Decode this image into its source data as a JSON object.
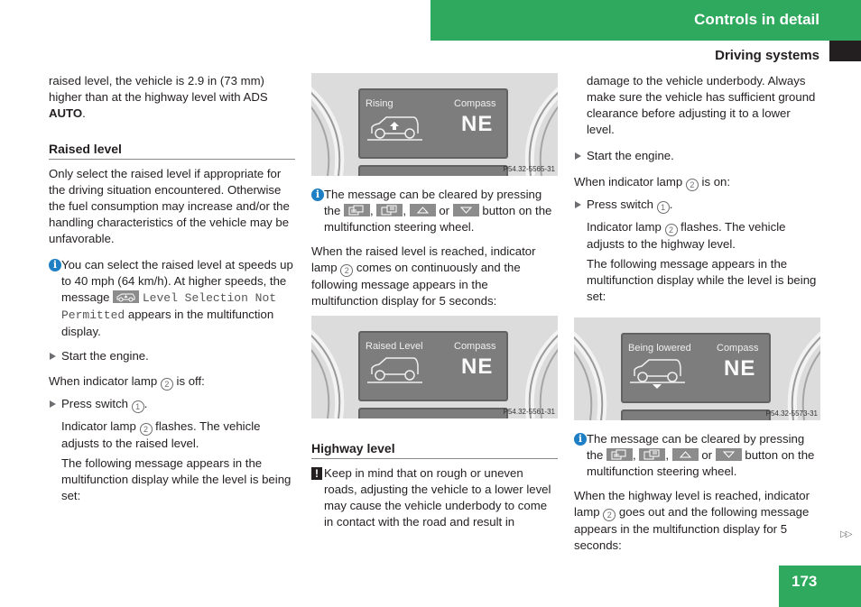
{
  "header": {
    "chapter": "Controls in detail",
    "section": "Driving systems"
  },
  "col1": {
    "intro": {
      "pre": "raised level, the vehicle is 2.9 in (73 mm) higher than at the highway level with ADS ",
      "bold": "AUTO",
      "post": "."
    },
    "raised_heading": "Raised level",
    "raised_para": "Only select the raised level if appropriate for the driving situation encountered. Otherwise the fuel consumption may increase and/or the handling characteristics of the vehicle may be unfavorable.",
    "note": {
      "icon": "info-icon",
      "pre": "You can select the raised level at speeds up to 40 mph (64 km/h). At higher speeds, the message ",
      "mono": "Level Selection Not Permitted",
      "post": " appears in the multifunction display."
    },
    "step_start": "Start the engine.",
    "condition": {
      "pre": "When indicator lamp ",
      "num": "2",
      "post": " is off:"
    },
    "step_press": {
      "pre": "Press switch ",
      "num": "1",
      "post": "."
    },
    "result1": {
      "pre": "Indicator lamp ",
      "num": "2",
      "post": " flashes. The vehicle adjusts to the raised level."
    },
    "result2": "The following message appears in the multifunction display while the level is being set:"
  },
  "col2": {
    "display1": {
      "left_label": "Rising",
      "right_label": "Compass",
      "direction": "NE",
      "fig_code": "P54.32-5565-31",
      "car_state": "rising"
    },
    "note": {
      "icon": "info-icon",
      "pre": "The message can be cleared by pressing the ",
      "sep1": ", ",
      "sep2": ", ",
      "sep3": " or ",
      "post": " button on the multifunction steering wheel."
    },
    "reached": {
      "pre": "When the raised level is reached, indicator lamp ",
      "num": "2",
      "post": " comes on continuously and the following message appears in the multifunction display for 5 seconds:"
    },
    "display2": {
      "left_label": "Raised Level",
      "right_label": "Compass",
      "direction": "NE",
      "fig_code": "P54.32-5561-31",
      "car_state": "raised"
    },
    "highway_heading": "Highway level",
    "warning": {
      "icon": "warning-icon",
      "text": "Keep in mind that on rough or uneven roads, adjusting the vehicle to a lower level may cause the vehicle underbody to come in contact with the road and result in"
    }
  },
  "col3": {
    "warning_cont": "damage to the vehicle underbody. Always make sure the vehicle has sufficient ground clearance before adjusting it to a lower level.",
    "step_start": "Start the engine.",
    "condition": {
      "pre": "When indicator lamp ",
      "num": "2",
      "post": " is on:"
    },
    "step_press": {
      "pre": "Press switch ",
      "num": "1",
      "post": "."
    },
    "result1": {
      "pre": "Indicator lamp ",
      "num": "2",
      "post": " flashes. The vehicle adjusts to the highway level."
    },
    "result2": "The following message appears in the multifunction display while the level is being set:",
    "display3": {
      "left_label": "Being lowered",
      "right_label": "Compass",
      "direction": "NE",
      "fig_code": "P54.32-5573-31",
      "car_state": "lowering"
    },
    "note": {
      "icon": "info-icon",
      "pre": "The message can be cleared by pressing the ",
      "sep1": ", ",
      "sep2": ", ",
      "sep3": " or ",
      "post": " button on the multifunction steering wheel."
    },
    "reached": {
      "pre": "When the highway level is reached, indicator lamp ",
      "num": "2",
      "post": " goes out and the following message appears in the multifunction display for 5 seconds:"
    }
  },
  "footer": {
    "page_number": "173",
    "continue_marker": "▷▷"
  },
  "colors": {
    "brand_green": "#2fa95e",
    "info_blue": "#1e7fc4",
    "text": "#231f20"
  }
}
